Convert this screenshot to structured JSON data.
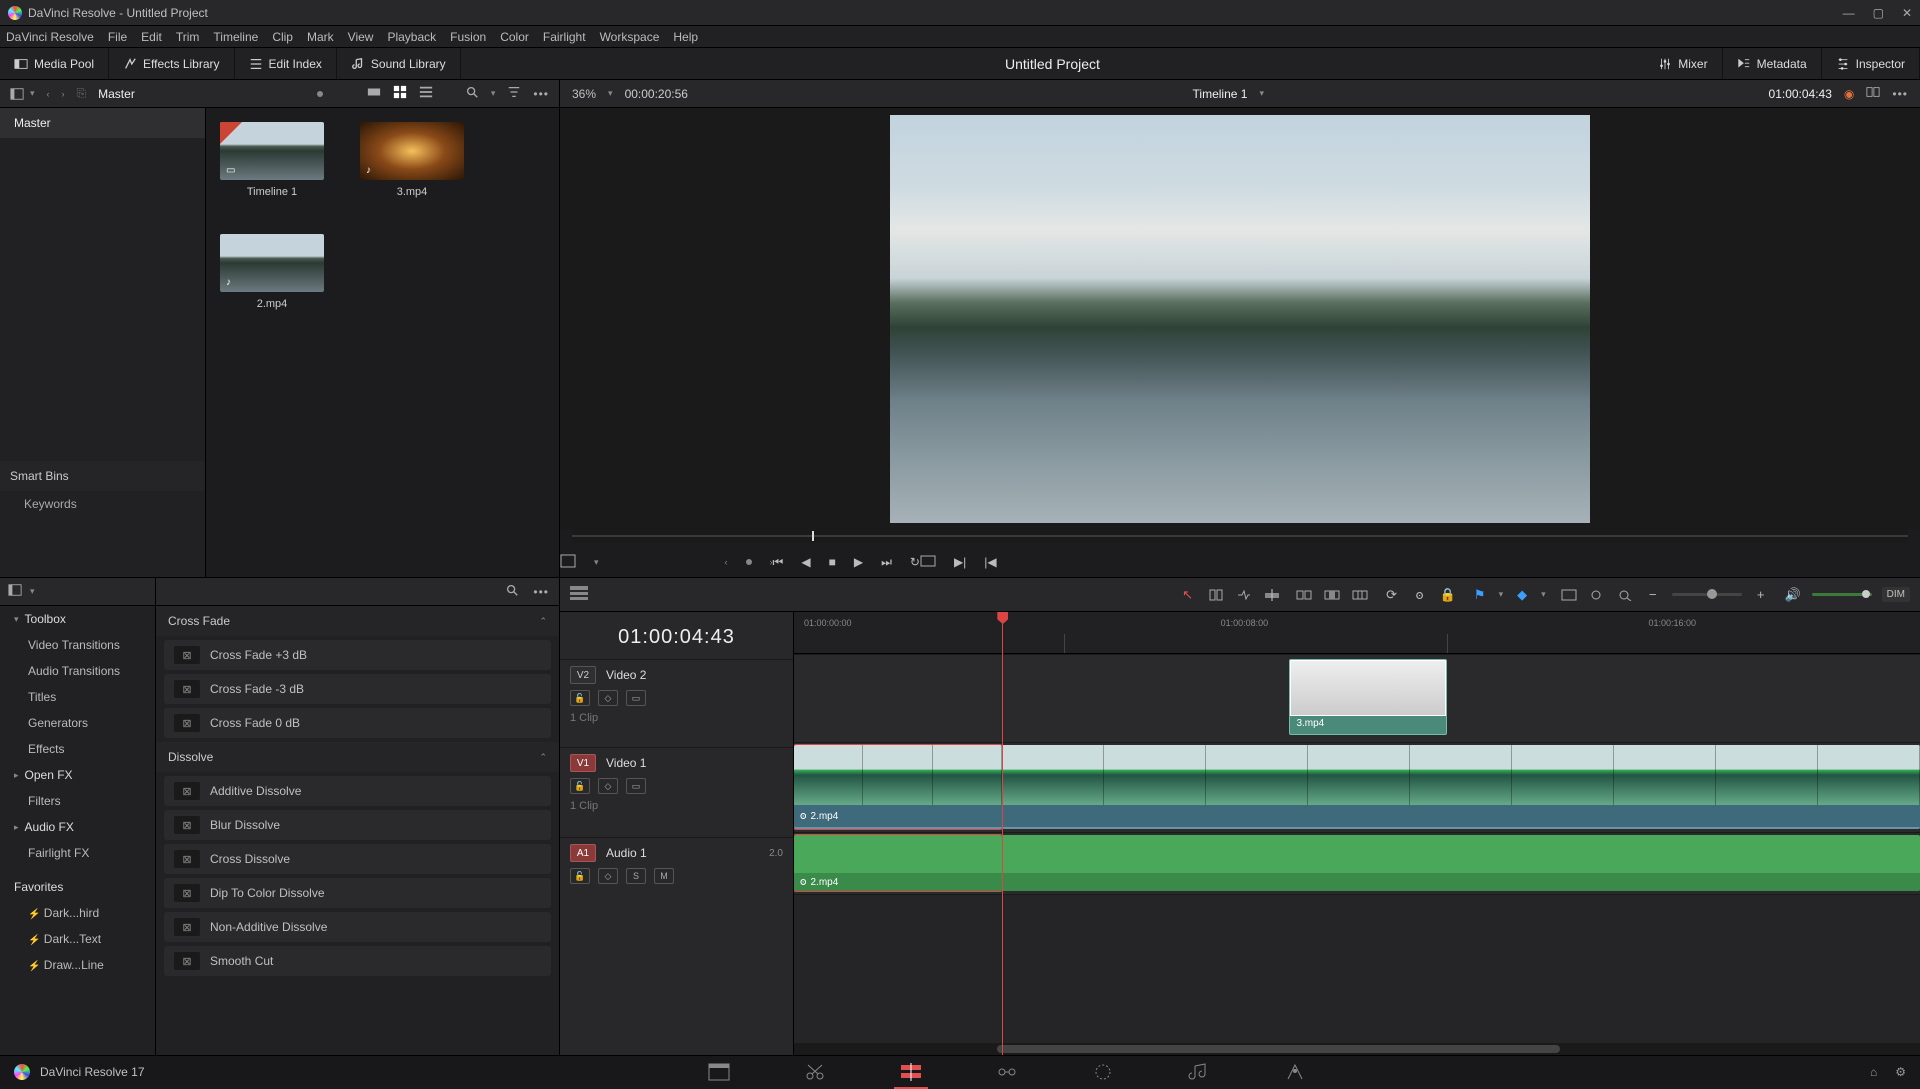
{
  "window": {
    "title": "DaVinci Resolve - Untitled Project"
  },
  "menubar": [
    "DaVinci Resolve",
    "File",
    "Edit",
    "Trim",
    "Timeline",
    "Clip",
    "Mark",
    "View",
    "Playback",
    "Fusion",
    "Color",
    "Fairlight",
    "Workspace",
    "Help"
  ],
  "toprow": {
    "media_pool": "Media Pool",
    "effects_lib": "Effects Library",
    "edit_index": "Edit Index",
    "sound_lib": "Sound Library",
    "project": "Untitled Project",
    "mixer": "Mixer",
    "metadata": "Metadata",
    "inspector": "Inspector"
  },
  "pool": {
    "bin": "Master",
    "smart_bins": "Smart Bins",
    "keywords": "Keywords",
    "clips": [
      {
        "name": "Timeline 1",
        "kind": "timeline"
      },
      {
        "name": "3.mp4",
        "kind": "video"
      },
      {
        "name": "2.mp4",
        "kind": "video"
      }
    ]
  },
  "viewer": {
    "zoom": "36%",
    "src_tc": "00:00:20:56",
    "timeline_name": "Timeline 1",
    "rec_tc": "01:00:04:43"
  },
  "fx": {
    "tree": {
      "toolbox": "Toolbox",
      "items": [
        "Video Transitions",
        "Audio Transitions",
        "Titles",
        "Generators",
        "Effects"
      ],
      "openfx": "Open FX",
      "filters": "Filters",
      "audiofx": "Audio FX",
      "fairlight": "Fairlight FX",
      "favorites": "Favorites",
      "favs": [
        "Dark...hird",
        "Dark...Text",
        "Draw...Line"
      ]
    },
    "groups": [
      {
        "title": "Cross Fade",
        "items": [
          "Cross Fade +3 dB",
          "Cross Fade -3 dB",
          "Cross Fade 0 dB"
        ]
      },
      {
        "title": "Dissolve",
        "items": [
          "Additive Dissolve",
          "Blur Dissolve",
          "Cross Dissolve",
          "Dip To Color Dissolve",
          "Non-Additive Dissolve",
          "Smooth Cut"
        ]
      }
    ]
  },
  "timeline": {
    "playhead_tc": "01:00:04:43",
    "tracks": {
      "v2": {
        "badge": "V2",
        "name": "Video 2",
        "clips": "1 Clip"
      },
      "v1": {
        "badge": "V1",
        "name": "Video 1",
        "clips": "1 Clip"
      },
      "a1": {
        "badge": "A1",
        "name": "Audio 1",
        "ch": "2.0"
      }
    },
    "ruler": [
      "01:00:00:00",
      "",
      "01:00:08:00",
      "",
      "01:00:16:00"
    ],
    "clip_v2": "3.mp4",
    "clip_v1": "2.mp4",
    "clip_a1": "2.mp4",
    "solo": "S",
    "mute": "M",
    "dim": "DIM"
  },
  "footer": {
    "app": "DaVinci Resolve 17"
  }
}
